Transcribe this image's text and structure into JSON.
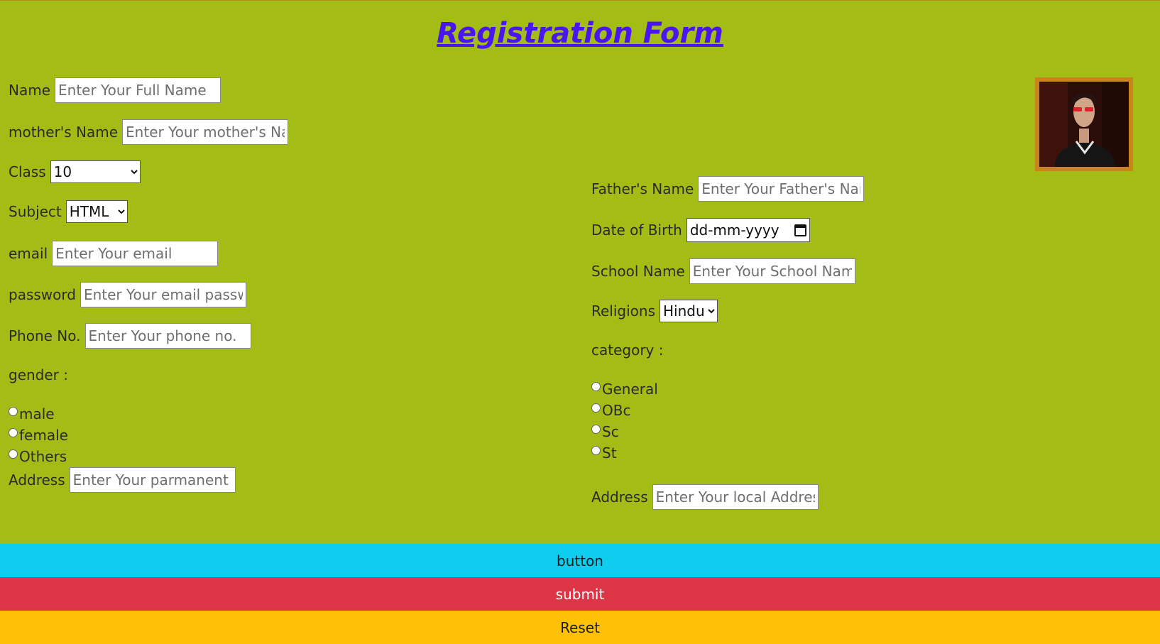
{
  "title": "Registration Form",
  "left": {
    "name": {
      "label": "Name",
      "placeholder": "Enter Your Full Name"
    },
    "mother": {
      "label": "mother's Name",
      "placeholder": "Enter Your mother's Name"
    },
    "class": {
      "label": "Class",
      "value": "10"
    },
    "subject": {
      "label": "Subject",
      "value": "HTML"
    },
    "email": {
      "label": "email",
      "placeholder": "Enter Your email"
    },
    "password": {
      "label": "password",
      "placeholder": "Enter Your email password"
    },
    "phone": {
      "label": "Phone No.",
      "placeholder": "Enter Your phone no."
    },
    "gender": {
      "label": "gender :",
      "options": [
        "male",
        "female",
        "Others"
      ]
    },
    "address": {
      "label": "Address",
      "placeholder": "Enter Your parmanent Address"
    }
  },
  "right": {
    "father": {
      "label": "Father's Name",
      "placeholder": "Enter Your Father's Name"
    },
    "dob": {
      "label": "Date of Birth",
      "value": "dd-mm-yyyy"
    },
    "school": {
      "label": "School Name",
      "placeholder": "Enter Your School Name"
    },
    "religion": {
      "label": "Religions",
      "value": "Hindu"
    },
    "category": {
      "label": "category :",
      "options": [
        "General",
        "OBc",
        "Sc",
        "St"
      ]
    },
    "address": {
      "label": "Address",
      "placeholder": "Enter Your local Address"
    }
  },
  "buttons": {
    "button": "button",
    "submit": "submit",
    "reset": "Reset"
  },
  "colors": {
    "background": "#a4bc16",
    "title": "#4a16f0",
    "button": "#0fcdee",
    "submit": "#dc3545",
    "reset": "#ffc107",
    "photo_border": "#c9851c"
  },
  "photo": {
    "icon": "profile-photo"
  }
}
